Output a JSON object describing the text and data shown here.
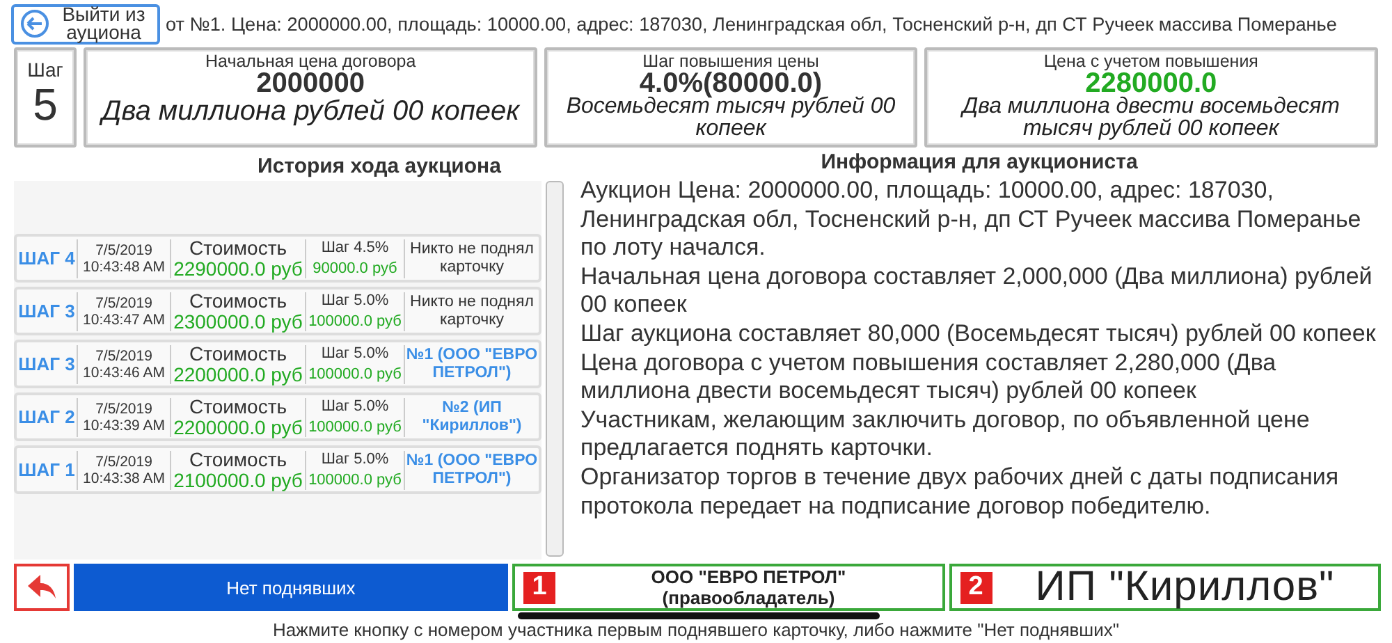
{
  "header": {
    "exit_button": "Выйти из ауциона",
    "lot_text": "от №1. Цена: 2000000.00, площадь: 10000.00, адрес: 187030, Ленинградская обл, Тосненский р-н, дп СТ Ручеек массива Померанье"
  },
  "summary": {
    "step": {
      "label": "Шаг",
      "value": "5"
    },
    "cards": [
      {
        "kind": "plain",
        "title": "Начальная цена договора",
        "value": "2000000",
        "words": "Два миллиона рублей 00 копеек"
      },
      {
        "kind": "plain",
        "title": "Шаг повышения цены",
        "value": "4.0%(80000.0)",
        "words": "Восемьдесят тысяч рублей 00 копеек"
      },
      {
        "kind": "highlight",
        "title": "Цена с учетом повышения",
        "value": "2280000.0",
        "words": "Два миллиона двести восемьдесят тысяч рублей 00 копеек"
      }
    ]
  },
  "history": {
    "title": "История хода аукциона",
    "rows": [
      {
        "step": "ШАГ 4",
        "date": "7/5/2019",
        "time": "10:43:48 AM",
        "cost_label": "Стоимость",
        "cost": "2290000.0 руб",
        "step_pct": "Шаг 4.5%",
        "step_amount": "90000.0 руб",
        "kind": "none",
        "result": "Никто не поднял карточку"
      },
      {
        "step": "ШАГ 3",
        "date": "7/5/2019",
        "time": "10:43:47 AM",
        "cost_label": "Стоимость",
        "cost": "2300000.0 руб",
        "step_pct": "Шаг 5.0%",
        "step_amount": "100000.0 руб",
        "kind": "none",
        "result": "Никто не поднял карточку"
      },
      {
        "step": "ШАГ 3",
        "date": "7/5/2019",
        "time": "10:43:46 AM",
        "cost_label": "Стоимость",
        "cost": "2200000.0 руб",
        "step_pct": "Шаг 5.0%",
        "step_amount": "100000.0 руб",
        "kind": "participant",
        "result": "№1 (ООО \"ЕВРО ПЕТРОЛ\")"
      },
      {
        "step": "ШАГ 2",
        "date": "7/5/2019",
        "time": "10:43:39 AM",
        "cost_label": "Стоимость",
        "cost": "2200000.0 руб",
        "step_pct": "Шаг 5.0%",
        "step_amount": "100000.0 руб",
        "kind": "participant",
        "result": "№2 (ИП \"Кириллов\")"
      },
      {
        "step": "ШАГ 1",
        "date": "7/5/2019",
        "time": "10:43:38 AM",
        "cost_label": "Стоимость",
        "cost": "2100000.0 руб",
        "step_pct": "Шаг 5.0%",
        "step_amount": "100000.0 руб",
        "kind": "participant",
        "result": "№1 (ООО \"ЕВРО ПЕТРОЛ\")"
      }
    ]
  },
  "info": {
    "title": "Информация для аукциониста",
    "paragraphs": [
      "Аукцион Цена: 2000000.00, площадь: 10000.00, адрес: 187030, Ленинградская обл, Тосненский р-н, дп СТ Ручеек массива Померанье по лоту начался.",
      "Начальная цена договора составляет 2,000,000 (Два миллиона) рублей 00 копеек",
      "Шаг аукциона составляет 80,000 (Восемьдесят тысяч) рублей 00 копеек",
      "Цена договора с учетом повышения составляет 2,280,000 (Два миллиона двести восемьдесят тысяч) рублей 00 копеек",
      "Участникам, желающим заключить договор, по объявленной цене предлагается поднять карточки.",
      "Организатор торгов в течение двух рабочих дней с даты подписания протокола передает на подписание договор победителю."
    ]
  },
  "actions": {
    "no_bid_button": "Нет поднявших",
    "participants": [
      {
        "number": "1",
        "name": "ООО \"ЕВРО ПЕТРОЛ\"",
        "role": "(правообладатель)"
      },
      {
        "number": "2",
        "name": "ИП \"Кириллов\""
      }
    ]
  },
  "hint": "Нажмите кнопку с номером участника первым поднявшего карточку, либо нажмите \"Нет поднявших\""
}
